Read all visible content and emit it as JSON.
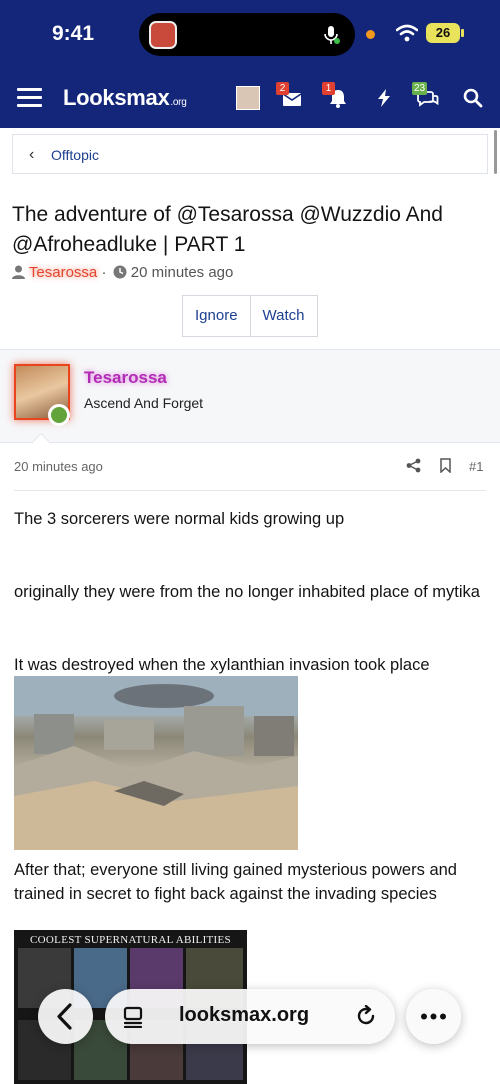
{
  "status_bar": {
    "time": "9:41",
    "battery": "26"
  },
  "nav": {
    "logo_main": "Looksmax",
    "logo_suffix": ".org",
    "inbox_badge": "2",
    "alerts_badge": "1",
    "chat_badge": "23"
  },
  "breadcrumb": {
    "label": "Offtopic"
  },
  "thread": {
    "title": "The adventure of @Tesarossa @Wuzzdio And @Afroheadluke | PART 1",
    "author": "Tesarossa",
    "separator": "·",
    "time": "20 minutes ago",
    "ignore_label": "Ignore",
    "watch_label": "Watch"
  },
  "post": {
    "username": "Tesarossa",
    "user_title": "Ascend And Forget",
    "time": "20 minutes ago",
    "number": "#1",
    "paragraphs": [
      "The 3 sorcerers were normal kids growing up",
      "originally they were from the no longer inhabited place of mytika",
      "It was destroyed when the xylanthian invasion took place",
      "After that; everyone still living gained mysterious powers and trained in secret to fight back against the invading species"
    ],
    "image2_caption": "COOLEST SUPERNATURAL ABILITIES"
  },
  "browser": {
    "url": "looksmax.org"
  }
}
